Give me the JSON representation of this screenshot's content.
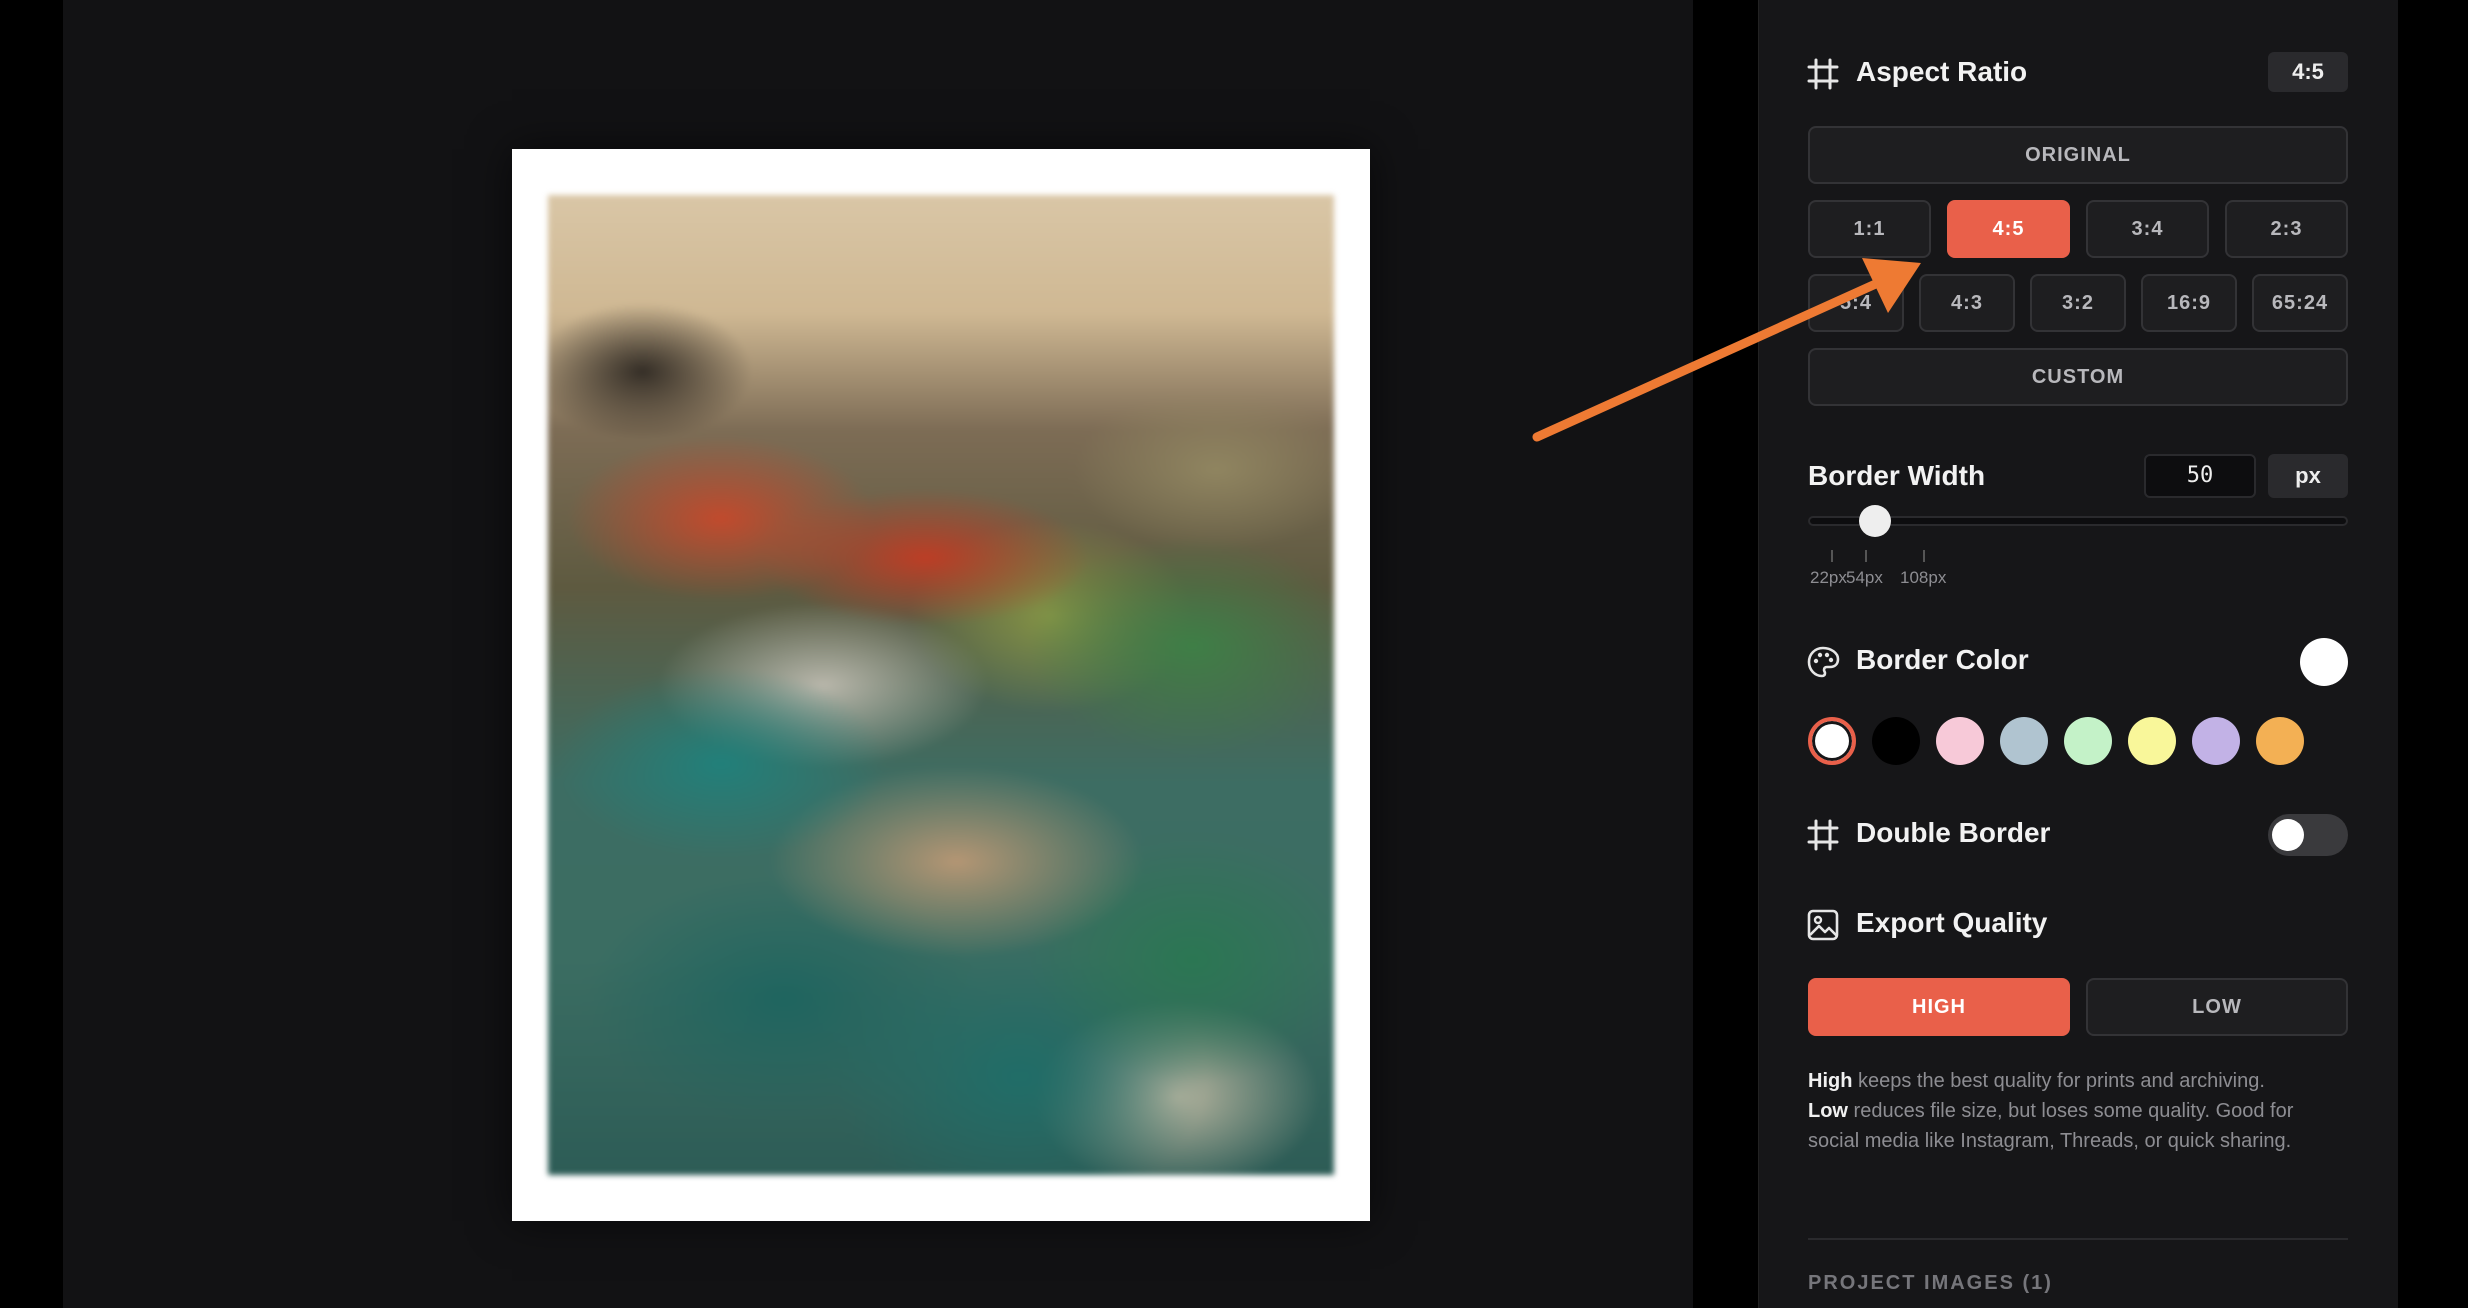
{
  "aspect_ratio": {
    "title": "Aspect Ratio",
    "current": "4:5",
    "original_label": "ORIGINAL",
    "row1": [
      "1:1",
      "4:5",
      "3:4",
      "2:3"
    ],
    "row2": [
      "5:4",
      "4:3",
      "3:2",
      "16:9",
      "65:24"
    ],
    "custom_label": "CUSTOM",
    "selected": "4:5"
  },
  "border_width": {
    "title": "Border Width",
    "value": "50",
    "unit": "px",
    "tick_labels": [
      "22px",
      "54px",
      "108px"
    ]
  },
  "border_color": {
    "title": "Border Color",
    "current": "#ffffff",
    "swatches": [
      "#ffffff",
      "#000000",
      "#f7c9d8",
      "#b0c4d0",
      "#c4f2c8",
      "#f9f79a",
      "#c2b2e6",
      "#f3b054"
    ],
    "selected_index": 0
  },
  "double_border": {
    "title": "Double Border",
    "enabled": false
  },
  "export_quality": {
    "title": "Export Quality",
    "options": [
      "HIGH",
      "LOW"
    ],
    "selected": "HIGH",
    "desc_high_label": "High",
    "desc_high_text": " keeps the best quality for prints and archiving.",
    "desc_low_label": "Low",
    "desc_low_text": " reduces file size, but loses some quality. Good for social media like Instagram, Threads, or quick sharing."
  },
  "project_images": {
    "label": "PROJECT IMAGES (1)"
  },
  "colors": {
    "accent": "#e9604a",
    "annotation_arrow": "#ee7a33"
  },
  "icons": {
    "aspect": "crop-grid-icon",
    "border_color": "palette-icon",
    "double_border": "crop-grid-icon",
    "export": "image-icon"
  }
}
